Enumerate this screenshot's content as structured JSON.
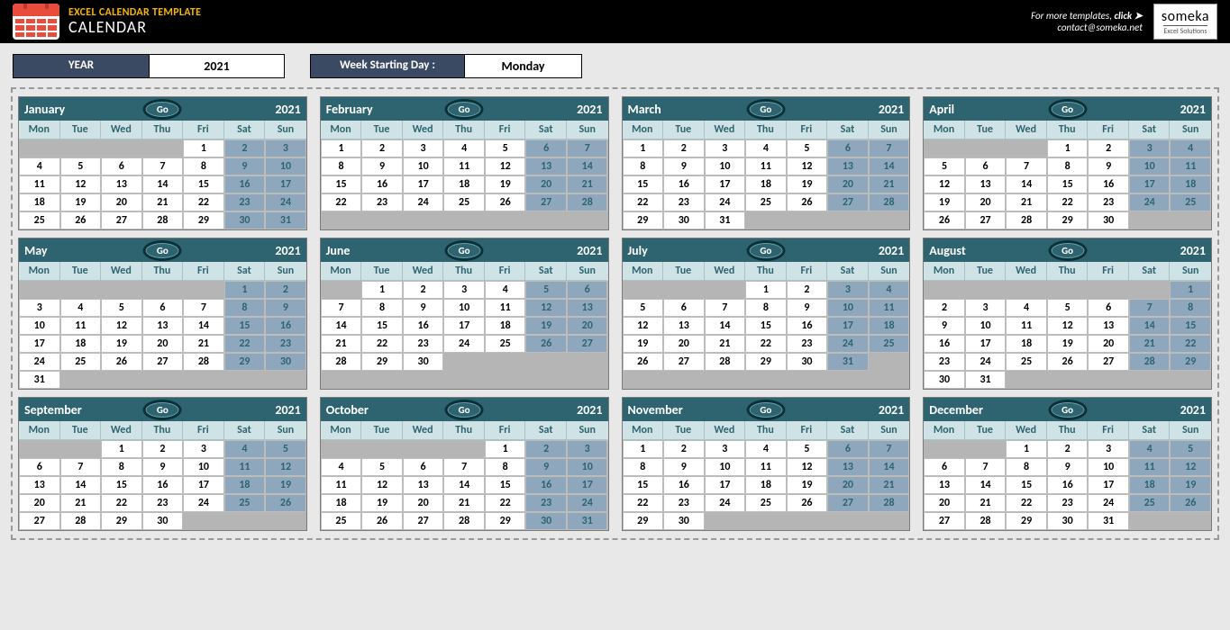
{
  "header": {
    "title1": "EXCEL CALENDAR TEMPLATE",
    "title2": "CALENDAR",
    "more_templates": "For more templates, ",
    "click_bold": "click ➤",
    "contact": "contact@someka.net",
    "logo_line1": "someka",
    "logo_line2": "Excel Solutions"
  },
  "controls": {
    "year_label": "YEAR",
    "year_value": "2021",
    "wsd_label": "Week Starting Day :",
    "wsd_value": "Monday"
  },
  "dow": [
    "Mon",
    "Tue",
    "Wed",
    "Thu",
    "Fri",
    "Sat",
    "Sun"
  ],
  "weekend_idx": [
    5,
    6
  ],
  "go_label": "Go",
  "months": [
    {
      "name": "January",
      "year": "2021",
      "offset": 4,
      "days": 31
    },
    {
      "name": "February",
      "year": "2021",
      "offset": 0,
      "days": 28
    },
    {
      "name": "March",
      "year": "2021",
      "offset": 0,
      "days": 31
    },
    {
      "name": "April",
      "year": "2021",
      "offset": 3,
      "days": 30
    },
    {
      "name": "May",
      "year": "2021",
      "offset": 5,
      "days": 31
    },
    {
      "name": "June",
      "year": "2021",
      "offset": 1,
      "days": 30
    },
    {
      "name": "July",
      "year": "2021",
      "offset": 3,
      "days": 31
    },
    {
      "name": "August",
      "year": "2021",
      "offset": 6,
      "days": 31
    },
    {
      "name": "September",
      "year": "2021",
      "offset": 2,
      "days": 30
    },
    {
      "name": "October",
      "year": "2021",
      "offset": 4,
      "days": 31
    },
    {
      "name": "November",
      "year": "2021",
      "offset": 0,
      "days": 30
    },
    {
      "name": "December",
      "year": "2021",
      "offset": 2,
      "days": 31
    }
  ]
}
